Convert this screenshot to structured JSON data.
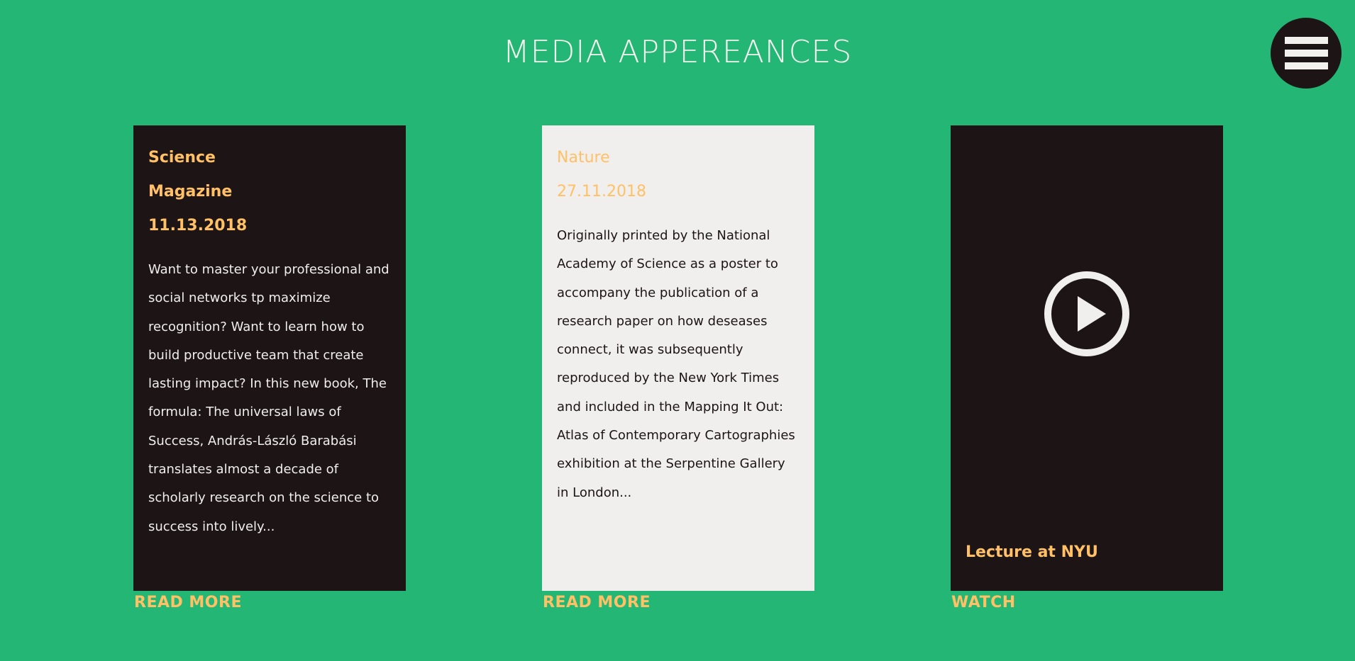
{
  "page": {
    "title": "MEDIA APPEREANCES"
  },
  "menu": {
    "icon": "hamburger-menu-icon"
  },
  "cards": [
    {
      "source": "Science",
      "subtitle": "Magazine",
      "date": "11.13.2018",
      "body": "Want to master your professional and social networks tp maximize recognition? Want to learn how to build productive team that create lasting impact? In this new book, The formula: The universal laws of Success, András-László Barabási translates almost a decade of scholarly research on the science to success into lively...",
      "link_label": "READ MORE"
    },
    {
      "source": "Nature",
      "date": "27.11.2018",
      "body": "Originally printed by the National Academy of Science as a poster to accompany the publication of a research paper on how deseases connect, it was subsequently reproduced by the New York Times and included in the Mapping It Out: Atlas of Contemporary Cartographies exhibition at the Serpentine Gallery in London...",
      "link_label": "READ MORE"
    },
    {
      "icon": "play-icon",
      "caption": "Lecture at NYU",
      "link_label": "WATCH"
    }
  ],
  "colors": {
    "background": "#24b674",
    "dark_card": "#1d1416",
    "light_card": "#f0efed",
    "accent": "#ffc066",
    "text_light": "#f3f1ee"
  }
}
